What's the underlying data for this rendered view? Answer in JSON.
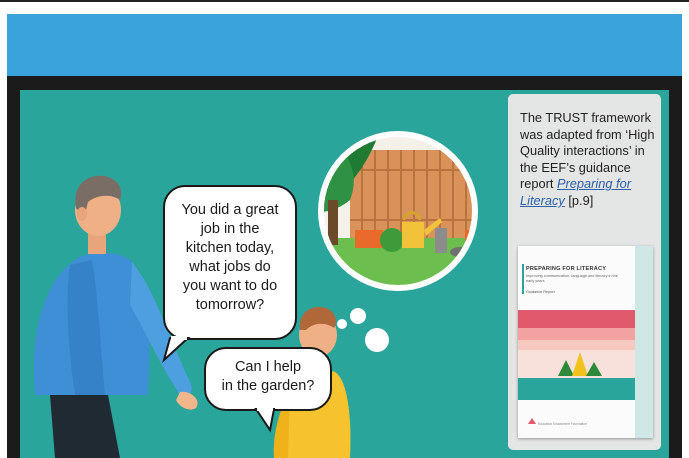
{
  "header": {
    "color": "#3ba3dc"
  },
  "scene": {
    "background": "#2aa59b",
    "speech_bubble_adult": "You did a great\njob in the\nkitchen today,\nwhat jobs do\nyou want to do\ntomorrow?",
    "speech_bubble_child": "Can I help\nin the garden?",
    "thought_bubble": {
      "content": "garden-scene-illustration"
    }
  },
  "sidebar": {
    "text_before_link": "The TRUST framework was adapted from ‘High Quality interactions’ in the EEF’s guidance report ",
    "link_text": "Preparing for Literacy",
    "text_after_link": " [p.9]",
    "report_cover": {
      "title": "PREPARING FOR LITERACY",
      "subtitle": "Improving communication, language and literacy in the early years",
      "label": "Guidance Report",
      "organisation": "Education Endowment Foundation",
      "org_short": "EEF"
    }
  },
  "icons": [
    "adult-figure-icon",
    "child-figure-icon",
    "thought-bubble-icon",
    "watering-can-icon"
  ]
}
